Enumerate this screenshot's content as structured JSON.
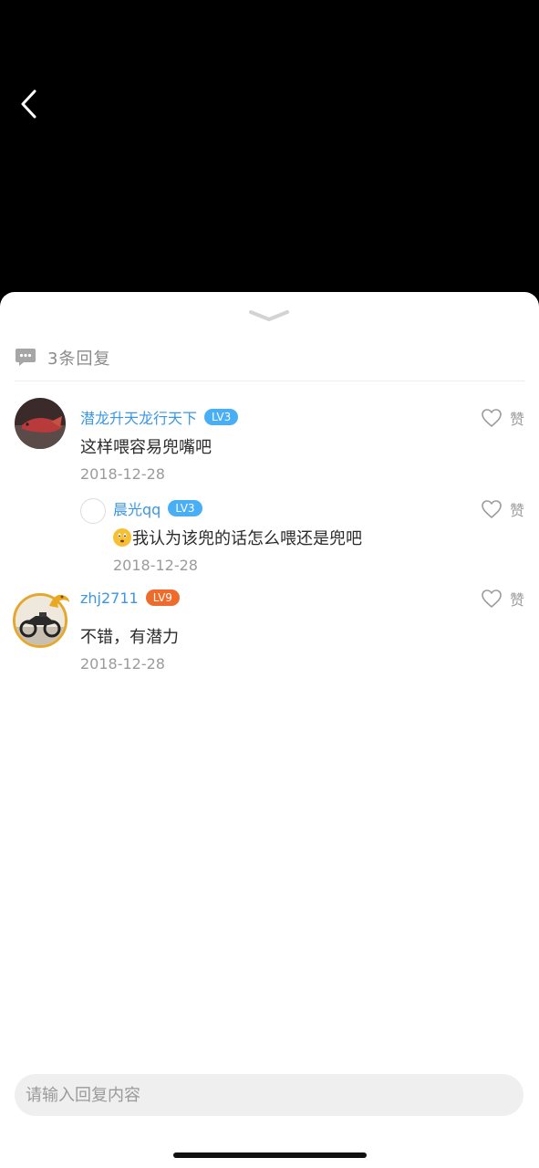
{
  "reply_count_label": "3条回复",
  "like_label": "赞",
  "input": {
    "placeholder": "请输入回复内容"
  },
  "replies": [
    {
      "username": "潜龙升天龙行天下",
      "level": "LV3",
      "content": "这样喂容易兜嘴吧",
      "date": "2018-12-28",
      "badge_color": "#48aef5"
    },
    {
      "username": "晨光qq",
      "level": "LV3",
      "content": "我认为该兜的话怎么喂还是兜吧",
      "date": "2018-12-28",
      "badge_color": "#48aef5",
      "has_emoji": true
    },
    {
      "username": "zhj2711",
      "level": "LV9",
      "content": "不错，有潜力",
      "date": "2018-12-28",
      "badge_color": "#ee6b2b"
    }
  ],
  "colors": {
    "accent_blue": "#3b97e3",
    "background_dark": "#000000",
    "sheet": "#ffffff"
  }
}
